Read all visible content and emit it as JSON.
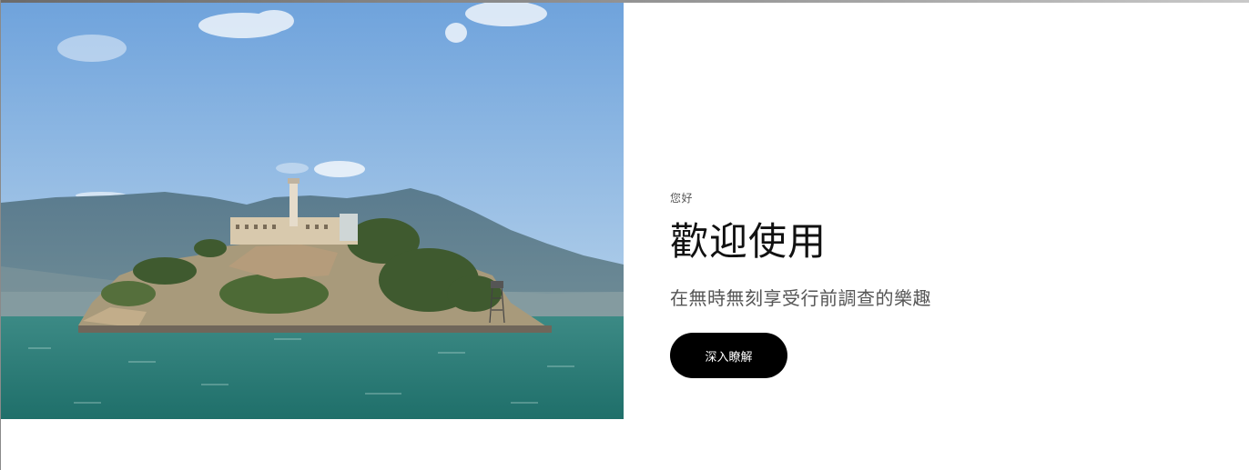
{
  "hero": {
    "image_alt": "Alcatraz Island in San Francisco Bay",
    "kicker": "您好",
    "headline": "歡迎使用",
    "subhead": "在無時無刻享受行前調查的樂趣",
    "cta_label": "深入瞭解"
  },
  "colors": {
    "sky_top": "#6fa3dc",
    "sky_bottom": "#a9cbe8",
    "water": "#2f7d78",
    "cta_bg": "#000000",
    "cta_text": "#ffffff"
  }
}
